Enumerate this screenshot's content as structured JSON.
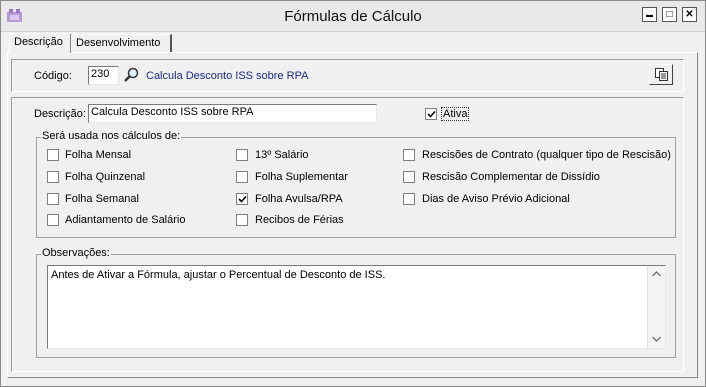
{
  "window": {
    "title": "Fórmulas de Cálculo",
    "minimize_symbol": "▬",
    "maximize_symbol": "□",
    "close_symbol": "✕"
  },
  "tabs": [
    {
      "label": "Descrição",
      "active": true
    },
    {
      "label": "Desenvolvimento",
      "active": false
    }
  ],
  "codigo": {
    "label": "Código:",
    "value": "230",
    "description": "Calcula Desconto ISS sobre RPA",
    "search_icon": "search-icon",
    "copy_icon": "copy-icon"
  },
  "descricao": {
    "label": "Descrição:",
    "value": "Calcula Desconto ISS sobre RPA"
  },
  "ativa": {
    "label": "Ativa",
    "checked": true
  },
  "calculos": {
    "legend": "Será usada nos cálculos de:",
    "options": [
      {
        "label": "Folha Mensal",
        "checked": false
      },
      {
        "label": "Folha Quinzenal",
        "checked": false
      },
      {
        "label": "Folha Semanal",
        "checked": false
      },
      {
        "label": "Adiantamento de Salário",
        "checked": false
      },
      {
        "label": "13º Salário",
        "checked": false
      },
      {
        "label": "Folha Suplementar",
        "checked": false
      },
      {
        "label": "Folha Avulsa/RPA",
        "checked": true
      },
      {
        "label": "Recibos de Férias",
        "checked": false
      },
      {
        "label": "Rescisões de Contrato (qualquer tipo de Rescisão)",
        "checked": false
      },
      {
        "label": "Rescisão Complementar de Dissídio",
        "checked": false
      },
      {
        "label": "Dias de Aviso Prévio Adicional",
        "checked": false
      }
    ]
  },
  "observacoes": {
    "legend": "Observações:",
    "text": "Antes de Ativar a Fórmula, ajustar o Percentual de Desconto de ISS."
  },
  "colors": {
    "link_text": "#1a2a8c",
    "window_bg": "#f0f0f0"
  }
}
